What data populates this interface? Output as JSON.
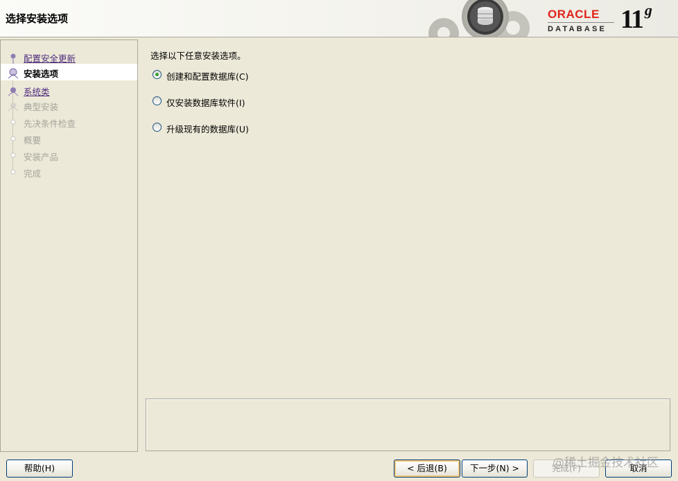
{
  "window": {
    "title": "选择安装选项"
  },
  "branding": {
    "oracle": "ORACLE",
    "database": "DATABASE",
    "version": "11",
    "version_suffix": "g",
    "brand_color": "#e2231a"
  },
  "nav": {
    "items": [
      {
        "label": "配置安全更新",
        "state": "link"
      },
      {
        "label": "安装选项",
        "state": "current"
      },
      {
        "label": "系统类",
        "state": "link"
      },
      {
        "label": "典型安装",
        "state": "disabled"
      },
      {
        "label": "先决条件检查",
        "state": "disabled"
      },
      {
        "label": "概要",
        "state": "disabled"
      },
      {
        "label": "安装产品",
        "state": "disabled"
      },
      {
        "label": "完成",
        "state": "disabled"
      }
    ]
  },
  "main": {
    "prompt": "选择以下任意安装选项。",
    "options": [
      {
        "label": "创建和配置数据库(C)",
        "checked": true
      },
      {
        "label": "仅安装数据库软件(I)",
        "checked": false
      },
      {
        "label": "升级现有的数据库(U)",
        "checked": false
      }
    ]
  },
  "buttons": {
    "help": "帮助(H)",
    "back": "< 后退(B)",
    "next": "下一步(N) >",
    "finish": "完成(F)",
    "cancel": "取消"
  },
  "watermark": "@稀土掘金技术社区"
}
